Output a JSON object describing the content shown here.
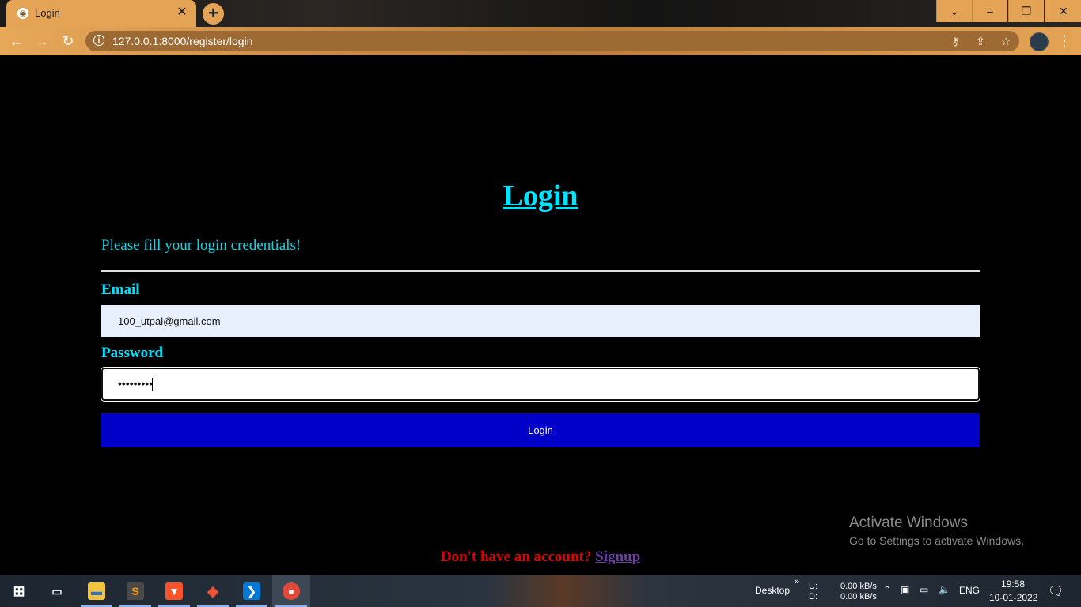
{
  "browser": {
    "tab_title": "Login",
    "tab_close": "✕",
    "new_tab": "+",
    "url": "127.0.0.1:8000/register/login",
    "window_controls": [
      "⌄",
      "–",
      "❐",
      "✕"
    ],
    "nav_icons": [
      "back-icon",
      "forward-icon",
      "reload-icon"
    ],
    "omnibox_icons": [
      "key-icon",
      "share-icon",
      "star-icon"
    ]
  },
  "page": {
    "heading": "Login",
    "subtitle": "Please fill your login credentials!",
    "email_label": "Email",
    "email_value": "100_utpal@gmail.com",
    "password_label": "Password",
    "password_value": "•••••••••",
    "login_button": "Login",
    "footer_text": "Don't have an account? ",
    "signup_link": "Signup"
  },
  "watermark": {
    "line1": "Activate Windows",
    "line2": "Go to Settings to activate Windows."
  },
  "taskbar": {
    "apps": [
      "windows-start-icon",
      "task-view-icon",
      "file-explorer-icon",
      "sublime-text-icon",
      "brave-icon",
      "git-icon",
      "vscode-icon",
      "chrome-icon"
    ],
    "desktop_label": "Desktop",
    "chevron": "»",
    "net_up_label": "U:",
    "net_down_label": "D:",
    "net_up": "0.00 kB/s",
    "net_down": "0.00 kB/s",
    "language": "ENG",
    "time": "19:58",
    "date": "10-01-2022"
  },
  "colors": {
    "accent_cyan": "#00e5ff",
    "button_blue": "#0000c8",
    "footer_red": "#e00000",
    "signup_purple": "#6b3fa0",
    "chrome_theme": "#e5a455"
  }
}
